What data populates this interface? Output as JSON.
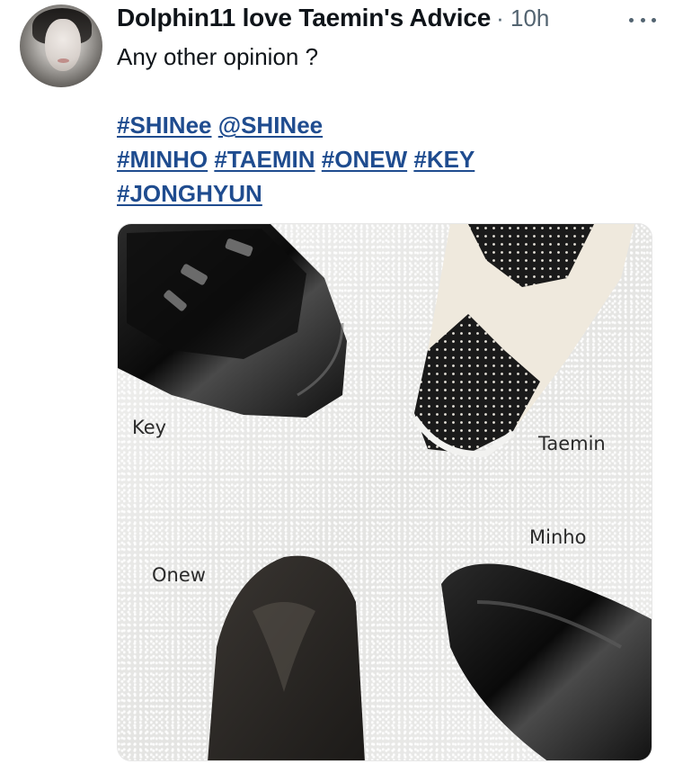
{
  "post": {
    "author": "Dolphin11 love Taemin's Advice",
    "time": "· 10h",
    "text": "Any other opinion ?",
    "tags": {
      "line1": [
        "#SHINee",
        "@SHINee"
      ],
      "line2": [
        "#MINHO",
        "#TAEMIN",
        "#ONEW",
        "#KEY"
      ],
      "line3": [
        "#JONGHYUN"
      ]
    }
  },
  "media": {
    "labels": {
      "key": "Key",
      "taemin": "Taemin",
      "minho": "Minho",
      "onew": "Onew"
    }
  },
  "icons": {
    "more": "more-options-icon"
  },
  "colors": {
    "link": "#1f4c8f",
    "secondary": "#536471",
    "text": "#0f1419"
  }
}
